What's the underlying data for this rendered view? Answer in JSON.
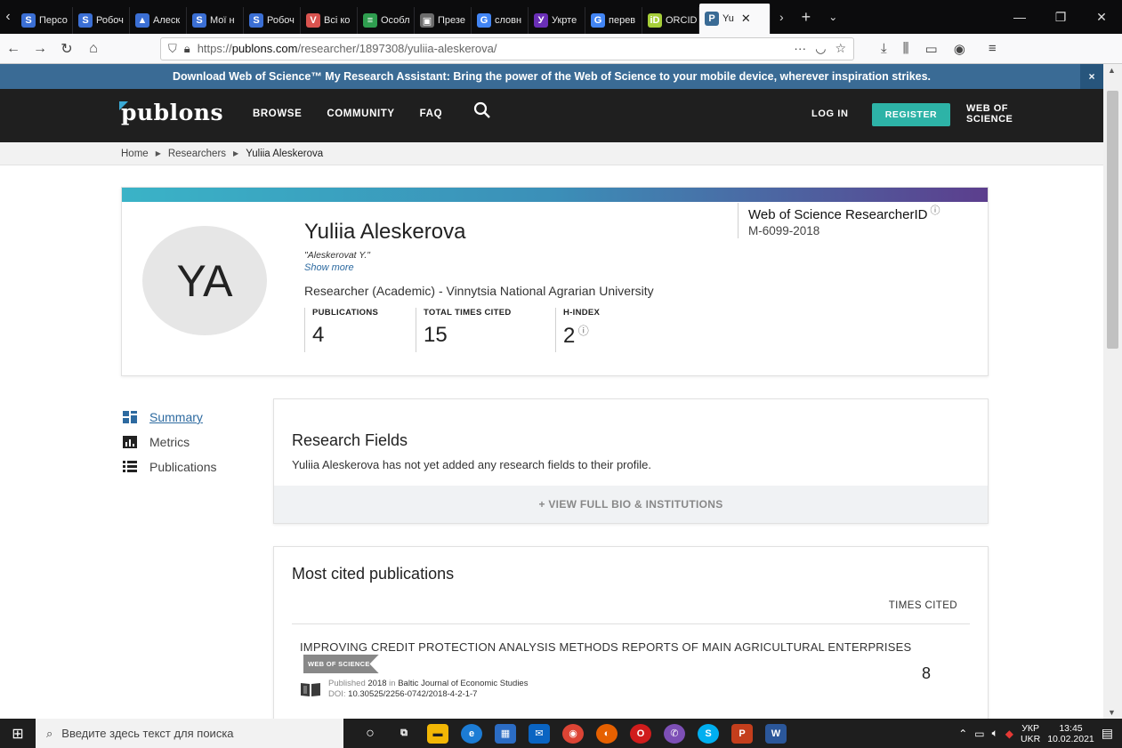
{
  "browser": {
    "tabs": [
      {
        "label": "Персо",
        "fav": "S",
        "color": "#3b6fd4"
      },
      {
        "label": "Робоч",
        "fav": "S",
        "color": "#3b6fd4"
      },
      {
        "label": "Алеск",
        "fav": "▲",
        "color": "#3b6fd4"
      },
      {
        "label": "Мої н",
        "fav": "S",
        "color": "#3b6fd4"
      },
      {
        "label": "Робоч",
        "fav": "S",
        "color": "#3b6fd4"
      },
      {
        "label": "Всі ко",
        "fav": "V",
        "color": "#d9534f"
      },
      {
        "label": "Особл",
        "fav": "≡",
        "color": "#2f9e4f"
      },
      {
        "label": "Презе",
        "fav": "▣",
        "color": "#6c6c6c"
      },
      {
        "label": "словн",
        "fav": "G",
        "color": "#4285f4"
      },
      {
        "label": "Укрте",
        "fav": "У",
        "color": "#6a2fb6"
      },
      {
        "label": "перев",
        "fav": "G",
        "color": "#4285f4"
      },
      {
        "label": "ORCID",
        "fav": "iD",
        "color": "#a6ce39"
      },
      {
        "label": "Yu",
        "fav": "P",
        "color": "#3a6b95",
        "active": true
      }
    ],
    "url": "https://publons.com/researcher/1897308/yuliia-aleskerova/",
    "url_host": "publons.com",
    "url_path": "/researcher/1897308/yuliia-aleskerova/"
  },
  "banner": {
    "text": "Download Web of Science™ My Research Assistant: Bring the power of the Web of Science to your mobile device, wherever inspiration strikes.",
    "close": "×"
  },
  "header": {
    "logo": "publons",
    "nav": [
      "BROWSE",
      "COMMUNITY",
      "FAQ"
    ],
    "login": "LOG IN",
    "register": "REGISTER",
    "wos_line1": "WEB OF",
    "wos_line2": "SCIENCE"
  },
  "breadcrumb": [
    "Home",
    "Researchers",
    "Yuliia Aleskerova"
  ],
  "profile": {
    "initials": "YA",
    "name": "Yuliia Aleskerova",
    "alias": "\"Aleskerovat Y.\"",
    "show_more": "Show more",
    "affiliation": "Researcher (Academic) - Vinnytsia National Agrarian University",
    "metrics": [
      {
        "label": "PUBLICATIONS",
        "value": "4"
      },
      {
        "label": "TOTAL TIMES CITED",
        "value": "15"
      },
      {
        "label": "H-INDEX",
        "value": "2"
      }
    ],
    "researcher_id_label": "Web of Science ResearcherID",
    "researcher_id": "M-6099-2018"
  },
  "sidemenu": [
    {
      "label": "Summary",
      "active": true
    },
    {
      "label": "Metrics"
    },
    {
      "label": "Publications"
    }
  ],
  "research": {
    "title": "Research Fields",
    "message": "Yuliia Aleskerova has not yet added any research fields to their profile.",
    "bio_button": "+ VIEW FULL BIO & INSTITUTIONS"
  },
  "most_cited": {
    "title": "Most cited publications",
    "times_cited_header": "TIMES CITED",
    "publications": [
      {
        "title": "IMPROVING CREDIT PROTECTION ANALYSIS METHODS REPORTS OF MAIN AGRICULTURAL ENTERPRISES",
        "badge": "WEB OF SCIENCE",
        "published_label": "Published",
        "year": "2018",
        "in_label": "in",
        "journal": "Baltic Journal of Economic Studies",
        "doi_label": "DOI:",
        "doi": "10.30525/2256-0742/2018-4-2-1-7",
        "times_cited": "8"
      }
    ]
  },
  "taskbar": {
    "search_placeholder": "Введите здесь текст для поиска",
    "lang_top": "УКР",
    "lang_bottom": "UKR",
    "time": "13:45",
    "date": "10.02.2021"
  }
}
